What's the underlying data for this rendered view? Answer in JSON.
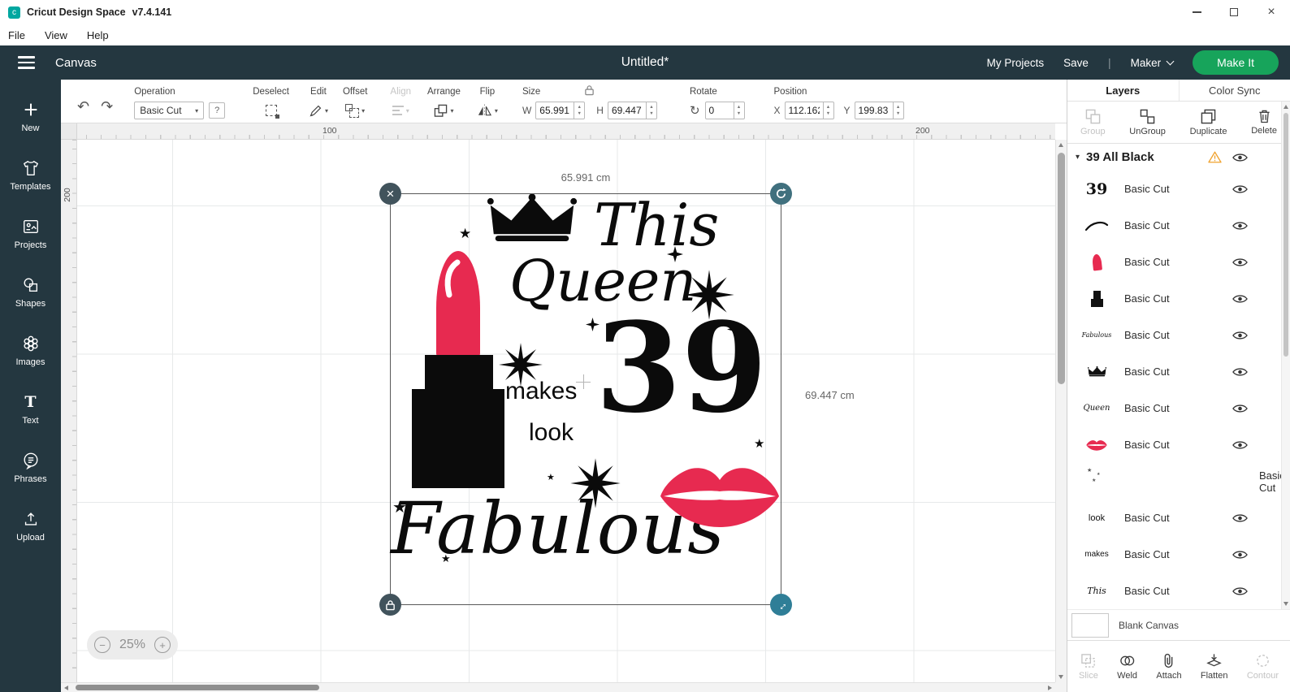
{
  "titlebar": {
    "app_title": "Cricut Design Space",
    "version": "v7.4.141"
  },
  "menubar": {
    "items": [
      "File",
      "View",
      "Help"
    ]
  },
  "header": {
    "canvas_label": "Canvas",
    "document_title": "Untitled*",
    "my_projects": "My Projects",
    "save": "Save",
    "divider": "|",
    "machine": "Maker",
    "make_it": "Make It"
  },
  "sidebar": {
    "items": [
      "New",
      "Templates",
      "Projects",
      "Shapes",
      "Images",
      "Text",
      "Phrases",
      "Upload"
    ]
  },
  "toolbar": {
    "operation_label": "Operation",
    "operation_value": "Basic Cut",
    "help": "?",
    "deselect_label": "Deselect",
    "edit_label": "Edit",
    "offset_label": "Offset",
    "align_label": "Align",
    "arrange_label": "Arrange",
    "flip_label": "Flip",
    "size_label": "Size",
    "w_label": "W",
    "w_value": "65.991",
    "h_label": "H",
    "h_value": "69.447",
    "rotate_label": "Rotate",
    "rotate_value": "0",
    "position_label": "Position",
    "x_label": "X",
    "x_value": "112.162",
    "y_label": "Y",
    "y_value": "199.83"
  },
  "canvas": {
    "ruler_top": [
      "100",
      "200"
    ],
    "ruler_left": [
      "200"
    ],
    "selection": {
      "width_label": "65.991 cm",
      "height_label": "69.447 cm"
    },
    "zoom": {
      "value": "25%"
    },
    "design": {
      "word_this": "This",
      "word_queen": "Queen",
      "number": "39",
      "word_makes": "makes",
      "word_look": "look",
      "word_fabulous": "Fabulous"
    }
  },
  "layers_panel": {
    "tabs": [
      "Layers",
      "Color Sync"
    ],
    "actions": [
      "Group",
      "UnGroup",
      "Duplicate",
      "Delete"
    ],
    "group_title": "39 All Black",
    "items": [
      {
        "label": "Basic Cut",
        "thumb": "numeral-39",
        "thumb_text": "39"
      },
      {
        "label": "Basic Cut",
        "thumb": "swoosh"
      },
      {
        "label": "Basic Cut",
        "thumb": "lipstick-pink"
      },
      {
        "label": "Basic Cut",
        "thumb": "lipstick-black"
      },
      {
        "label": "Basic Cut",
        "thumb": "fabulous-script",
        "thumb_text": "Fabulous"
      },
      {
        "label": "Basic Cut",
        "thumb": "crown"
      },
      {
        "label": "Basic Cut",
        "thumb": "queen-script",
        "thumb_text": "Queen"
      },
      {
        "label": "Basic Cut",
        "thumb": "lips"
      },
      {
        "label": "Basic Cut",
        "thumb": "sparkles"
      },
      {
        "label": "Basic Cut",
        "thumb": "look-text",
        "thumb_text": "look"
      },
      {
        "label": "Basic Cut",
        "thumb": "makes-text",
        "thumb_text": "makes"
      },
      {
        "label": "Basic Cut",
        "thumb": "this-script",
        "thumb_text": "This"
      }
    ],
    "blank_canvas": "Blank Canvas",
    "bottom_actions": [
      "Slice",
      "Weld",
      "Attach",
      "Flatten",
      "Contour"
    ]
  },
  "icons": {
    "close": "×",
    "caret_down": "▾",
    "stepper_up": "▲",
    "stepper_down": "▼",
    "undo": "↶",
    "redo": "↷",
    "rotate": "↻",
    "star": "★",
    "minus": "−",
    "plus": "+",
    "resize": "↔",
    "text_tool": "T"
  },
  "colors": {
    "header_dark": "#243740",
    "accent_green": "#17A45B",
    "pink": "#E72A50",
    "warning": "#F0A22E"
  }
}
